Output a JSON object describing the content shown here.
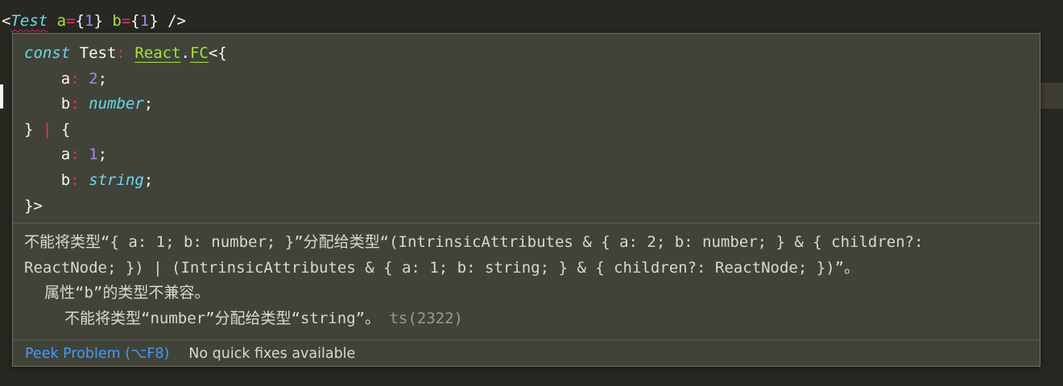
{
  "editor": {
    "code_tokens": {
      "lt": "<",
      "tag": "Test",
      "attr_a": "a",
      "eq_a": "=",
      "brace_open_a": "{",
      "val_a": "1",
      "brace_close_a": "}",
      "attr_b": "b",
      "eq_b": "=",
      "brace_open_b": "{",
      "val_b": "1",
      "brace_close_b": "}",
      "self_close": "/>"
    }
  },
  "hover": {
    "signature": {
      "line1": {
        "kw": "const",
        "name": "Test",
        "colon": ":",
        "type_ns": "React",
        "dot": ".",
        "type_name": "FC",
        "tail": "<{"
      },
      "line2": {
        "prop": "a",
        "colon": ":",
        "value": "2",
        "semi": ";"
      },
      "line3": {
        "prop": "b",
        "colon": ":",
        "value": "number",
        "semi": ";"
      },
      "line4": {
        "close": "}",
        "pipe": "|",
        "open": "{"
      },
      "line5": {
        "prop": "a",
        "colon": ":",
        "value": "1",
        "semi": ";"
      },
      "line6": {
        "prop": "b",
        "colon": ":",
        "value": "string",
        "semi": ";"
      },
      "line7": {
        "close": "}>"
      }
    },
    "diagnostic": {
      "line1": "不能将类型“{ a: 1; b: number; }”分配给类型“(IntrinsicAttributes & { a: 2; b: number; } & { children?:",
      "line2": "ReactNode; }) | (IntrinsicAttributes & { a: 1; b: string; } & { children?: ReactNode; })”。",
      "line3": "属性“b”的类型不兼容。",
      "line4": "不能将类型“number”分配给类型“string”。",
      "code": "ts(2322)"
    },
    "status_bar": {
      "peek_problem": "Peek Problem (⌥F8)",
      "no_fixes": "No quick fixes available"
    }
  },
  "colors": {
    "editor_background": "#272822",
    "hover_background": "#414339",
    "link": "#3e9bff",
    "keyword": "#66d9ef",
    "type": "#a6e22e",
    "operator": "#f92672",
    "number": "#ae81ff"
  }
}
